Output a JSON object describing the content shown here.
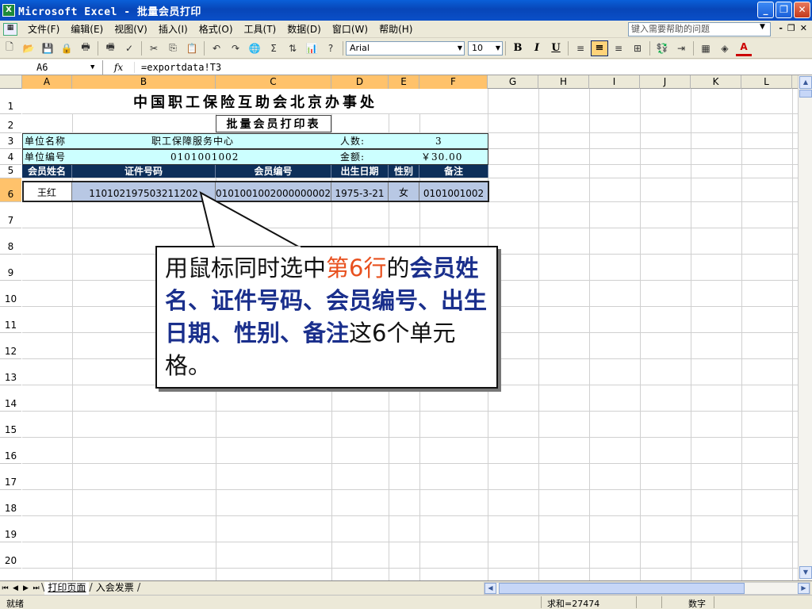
{
  "window": {
    "title": "Microsoft Excel - 批量会员打印",
    "app_icon": "X",
    "min": "_",
    "restore": "❐",
    "close": "✕"
  },
  "menu": {
    "items": [
      "文件(F)",
      "编辑(E)",
      "视图(V)",
      "插入(I)",
      "格式(O)",
      "工具(T)",
      "数据(D)",
      "窗口(W)",
      "帮助(H)"
    ],
    "help_placeholder": "键入需要帮助的问题",
    "mdi_min": "-",
    "mdi_restore": "❐",
    "mdi_close": "✕"
  },
  "toolbar": {
    "font_name": "Arial",
    "font_size": "10",
    "bold": "B",
    "italic": "I",
    "underline": "U",
    "sum": "Σ"
  },
  "formula_bar": {
    "name_box": "A6",
    "fx": "fx",
    "formula": "=exportdata!T3"
  },
  "columns": [
    "A",
    "B",
    "C",
    "D",
    "E",
    "F",
    "G",
    "H",
    "I",
    "J",
    "K",
    "L"
  ],
  "rows": [
    "1",
    "2",
    "3",
    "4",
    "5",
    "6",
    "7",
    "8",
    "9",
    "10",
    "11",
    "12",
    "13",
    "14",
    "15",
    "16",
    "17",
    "18",
    "19",
    "20"
  ],
  "sheet": {
    "title": "中国职工保险互助会北京办事处",
    "subtitle": "批量会员打印表",
    "unit_name_label": "单位名称",
    "unit_name": "职工保障服务中心",
    "count_label": "人数:",
    "count": "3",
    "unit_code_label": "单位编号",
    "unit_code": "0101001002",
    "amount_label": "金额:",
    "amount": "￥30.00",
    "headers": [
      "会员姓名",
      "证件号码",
      "会员编号",
      "出生日期",
      "性别",
      "备注"
    ],
    "row6": [
      "王红",
      "110102197503211202",
      "0101001002000000002",
      "1975-3-21",
      "女",
      "0101001002"
    ]
  },
  "callout": {
    "part1": "用鼠标同时选中",
    "part2": "第6行",
    "part3": "的",
    "part4": "会员姓名、证件号码、会员编号、出生日期、性别、备注",
    "part5": "这6个单元格。"
  },
  "tabs": {
    "nav": [
      "⏮",
      "◀",
      "▶",
      "⏭"
    ],
    "sheets": [
      "打印页面",
      "入会发票"
    ]
  },
  "status": {
    "ready": "就绪",
    "sum": "求和=27474",
    "mode": "数字"
  },
  "colors": {
    "accent": "#0a5fd8",
    "header_fill": "#0d2f5a",
    "info_fill": "#ccffff",
    "selection": "#b8c8e4",
    "highlight_red": "#e8501e",
    "highlight_blue": "#1a2f8c"
  }
}
